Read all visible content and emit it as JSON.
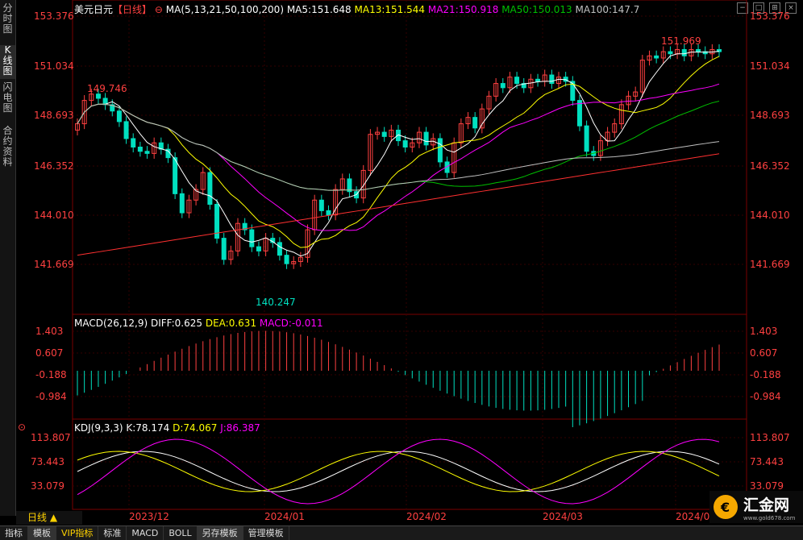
{
  "side_tabs": [
    "分时图",
    "K线图",
    "闪电图",
    "合约资料"
  ],
  "main": {
    "symbol": "美元日元",
    "period_tag": "【日线】",
    "ma_label": "MA(5,13,21,50,100,200)",
    "ma5": "MA5:151.648",
    "ma13": "MA13:151.544",
    "ma21": "MA21:150.918",
    "ma50": "MA50:150.013",
    "ma100": "MA100:147.7",
    "y_labels": [
      "153.376",
      "151.034",
      "148.693",
      "146.352",
      "144.010",
      "141.669"
    ],
    "high_label": "151.969",
    "left_high_label": "149.746",
    "low_label": "140.247"
  },
  "macd": {
    "title": "MACD(26,12,9)",
    "diff": "DIFF:0.625",
    "dea": "DEA:0.631",
    "macd": "MACD:-0.011",
    "y_labels": [
      "1.403",
      "0.607",
      "-0.188",
      "-0.984"
    ]
  },
  "kdj": {
    "title": "KDJ(9,3,3)",
    "k": "K:78.174",
    "d": "D:74.067",
    "j": "J:86.387",
    "y_labels": [
      "113.807",
      "73.443",
      "33.079"
    ]
  },
  "x_labels": [
    "2023/12",
    "2024/01",
    "2024/02",
    "2024/03",
    "2024/0"
  ],
  "period_tab": "日线 ▲",
  "bottom_tabs": [
    "指标",
    "模板",
    "VIP指标",
    "标准",
    "MACD",
    "BOLL",
    "另存模板",
    "管理模板"
  ],
  "logo": {
    "text": "汇金网",
    "url": "www.gold678.com"
  },
  "colors": {
    "up": "#ff4040",
    "down": "#00e0c0",
    "ma5": "#ffffff",
    "ma13": "#ffff00",
    "ma21": "#ff00ff",
    "ma50": "#00c000",
    "ma100": "#c0c0c0",
    "ma200": "#ff3030"
  }
}
